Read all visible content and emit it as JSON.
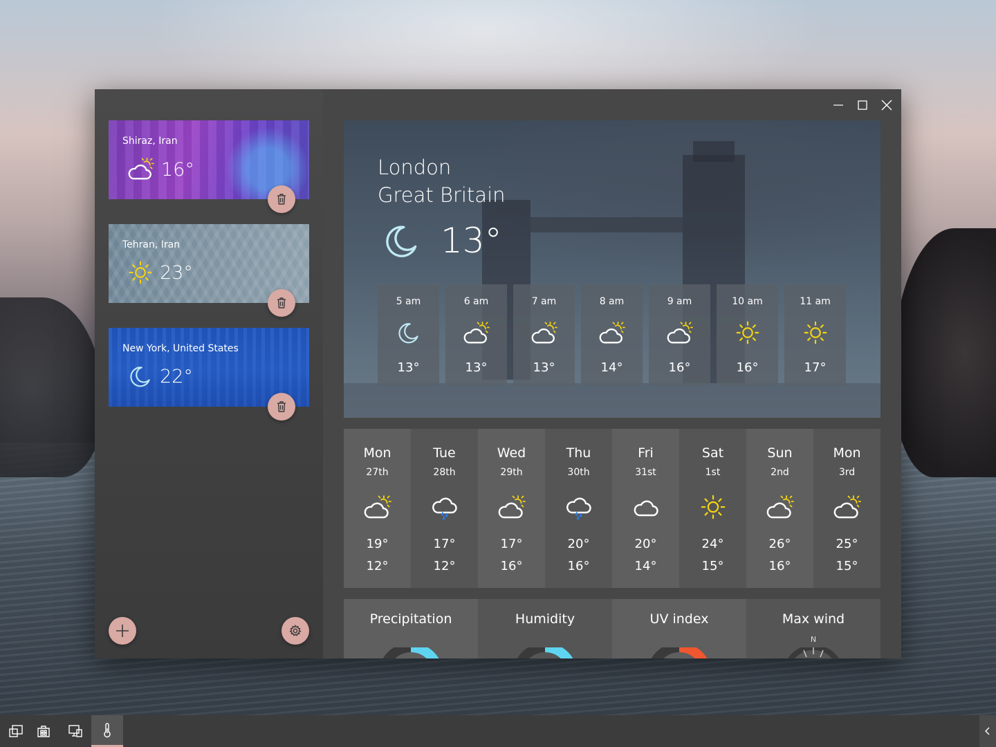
{
  "window": {
    "controls": [
      "minimize",
      "maximize",
      "close"
    ]
  },
  "cities": [
    {
      "name": "Shiraz, Iran",
      "temp": "16°",
      "icon": "partly-cloudy-icon"
    },
    {
      "name": "Tehran, Iran",
      "temp": "23°",
      "icon": "sun-icon"
    },
    {
      "name": "New York, United States",
      "temp": "22°",
      "icon": "moon-icon"
    }
  ],
  "current": {
    "city": "London",
    "country": "Great Britain",
    "temp": "13°",
    "icon": "moon-icon"
  },
  "hourly": [
    {
      "time": "5 am",
      "temp": "13°",
      "icon": "moon"
    },
    {
      "time": "6 am",
      "temp": "13°",
      "icon": "partly-cloudy"
    },
    {
      "time": "7 am",
      "temp": "13°",
      "icon": "partly-cloudy"
    },
    {
      "time": "8 am",
      "temp": "14°",
      "icon": "partly-cloudy"
    },
    {
      "time": "9 am",
      "temp": "16°",
      "icon": "partly-cloudy"
    },
    {
      "time": "10 am",
      "temp": "16°",
      "icon": "sun"
    },
    {
      "time": "11 am",
      "temp": "17°",
      "icon": "sun"
    }
  ],
  "daily": [
    {
      "day": "Mon",
      "date": "27th",
      "high": "19°",
      "low": "12°",
      "icon": "partly-cloudy"
    },
    {
      "day": "Tue",
      "date": "28th",
      "high": "17°",
      "low": "12°",
      "icon": "rain"
    },
    {
      "day": "Wed",
      "date": "29th",
      "high": "17°",
      "low": "16°",
      "icon": "partly-cloudy"
    },
    {
      "day": "Thu",
      "date": "30th",
      "high": "20°",
      "low": "16°",
      "icon": "rain"
    },
    {
      "day": "Fri",
      "date": "31st",
      "high": "20°",
      "low": "14°",
      "icon": "cloud"
    },
    {
      "day": "Sat",
      "date": "1st",
      "high": "24°",
      "low": "15°",
      "icon": "sun"
    },
    {
      "day": "Sun",
      "date": "2nd",
      "high": "26°",
      "low": "16°",
      "icon": "partly-cloudy"
    },
    {
      "day": "Mon",
      "date": "3rd",
      "high": "25°",
      "low": "15°",
      "icon": "partly-cloudy"
    }
  ],
  "details": [
    {
      "label": "Precipitation",
      "gauge_color": "#5fd4f0"
    },
    {
      "label": "Humidity",
      "gauge_color": "#5fd4f0"
    },
    {
      "label": "UV index",
      "gauge_color": "#f0562f"
    },
    {
      "label": "Max wind",
      "compass_label": "N"
    }
  ],
  "colors": {
    "accent": "#d9a9a3",
    "sun": "#f5d410",
    "moon": "#bfe9f5",
    "rain": "#2f7be0"
  },
  "taskbar": {
    "items": [
      "window-icon",
      "store-icon",
      "devices-icon",
      "thermometer-icon"
    ],
    "active": "thermometer-icon"
  }
}
